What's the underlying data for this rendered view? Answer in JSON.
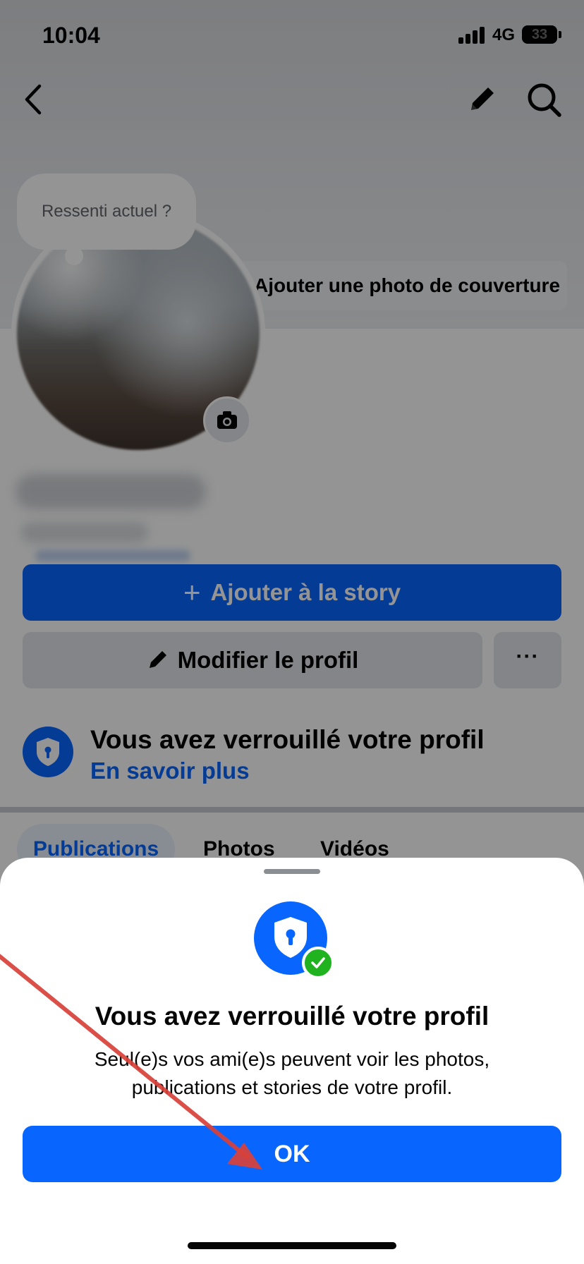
{
  "status_bar": {
    "time": "10:04",
    "network": "4G",
    "battery": "33"
  },
  "profile": {
    "mood_prompt": "Ressenti actuel ?",
    "add_cover_label": "Ajouter une photo de couverture",
    "add_story_label": "Ajouter à la story",
    "edit_profile_label": "Modifier le profil",
    "more_label": "···",
    "lock_title": "Vous avez verrouillé votre profil",
    "lock_link": "En savoir plus",
    "tabs": [
      {
        "label": "Publications",
        "active": true
      },
      {
        "label": "Photos"
      },
      {
        "label": "Vidéos"
      }
    ]
  },
  "sheet": {
    "title": "Vous avez verrouillé votre profil",
    "body": "Seul(e)s vos ami(e)s peuvent voir les photos, publications et stories de votre profil.",
    "ok_label": "OK"
  },
  "icons": {
    "back": "chevron-left-icon",
    "edit": "pencil-icon",
    "search": "search-icon",
    "camera": "camera-icon",
    "shield": "shield-lock-icon",
    "check": "check-icon"
  },
  "colors": {
    "primary": "#0866ff",
    "secondary_button": "#e4e6eb",
    "success": "#20b21f",
    "annotation": "#d9413a"
  }
}
